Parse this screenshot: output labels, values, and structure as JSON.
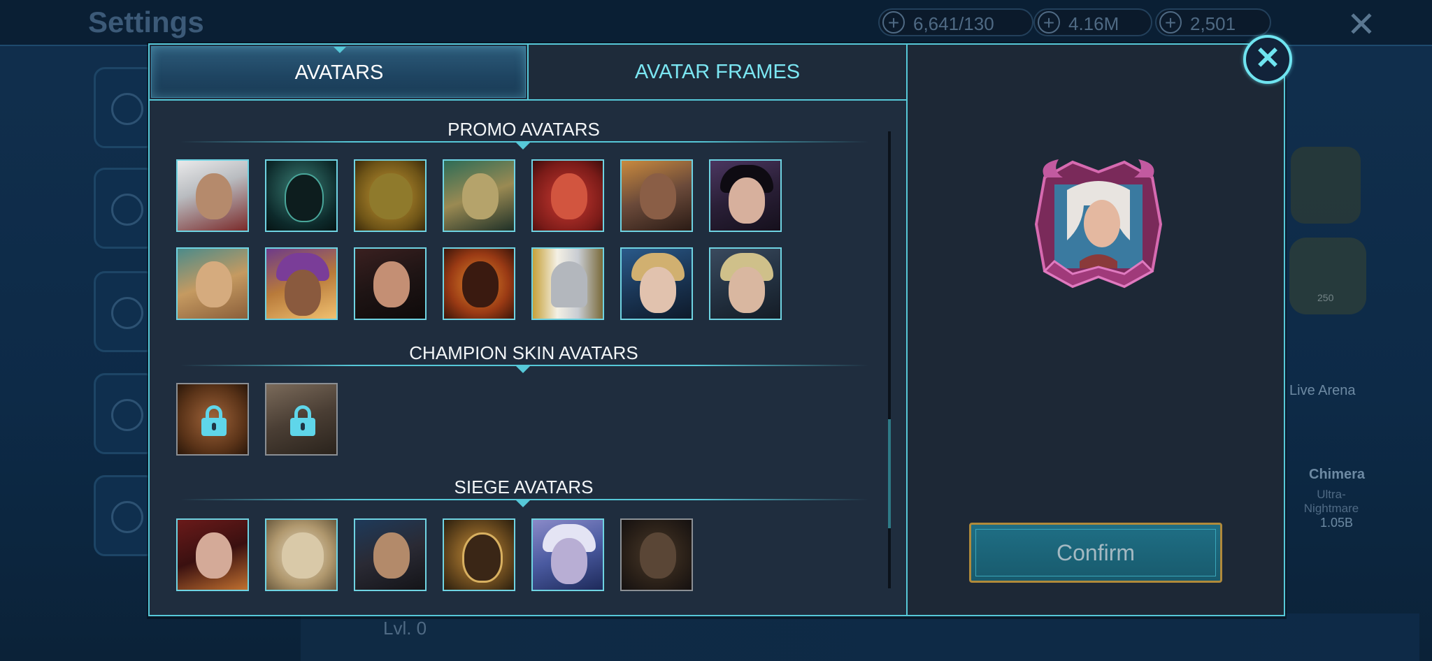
{
  "background": {
    "title": "Settings",
    "resources": [
      {
        "value": "6,641/130",
        "icon": "energy-icon"
      },
      {
        "value": "4.16M",
        "icon": "silver-icon"
      },
      {
        "value": "2,501",
        "icon": "gem-icon"
      }
    ],
    "right_panel": {
      "live_arena_label": "Live Arena",
      "chimera_label": "Chimera",
      "chimera_difficulty": "Ultra-Nightmare",
      "chimera_damage": "1.05B",
      "badge_number": "250"
    },
    "level_text": "Lvl. 0"
  },
  "modal": {
    "tabs": [
      {
        "label": "AVATARS",
        "active": true
      },
      {
        "label": "AVATAR FRAMES",
        "active": false
      }
    ],
    "sections": [
      {
        "title": "PROMO AVATARS",
        "count": 14
      },
      {
        "title": "CHAMPION SKIN AVATARS",
        "count": 2,
        "locked": true
      },
      {
        "title": "SIEGE AVATARS",
        "count": 6
      }
    ],
    "confirm_label": "Confirm",
    "colors": {
      "accent": "#56c8d8",
      "confirm_border": "#b08a3a"
    }
  }
}
